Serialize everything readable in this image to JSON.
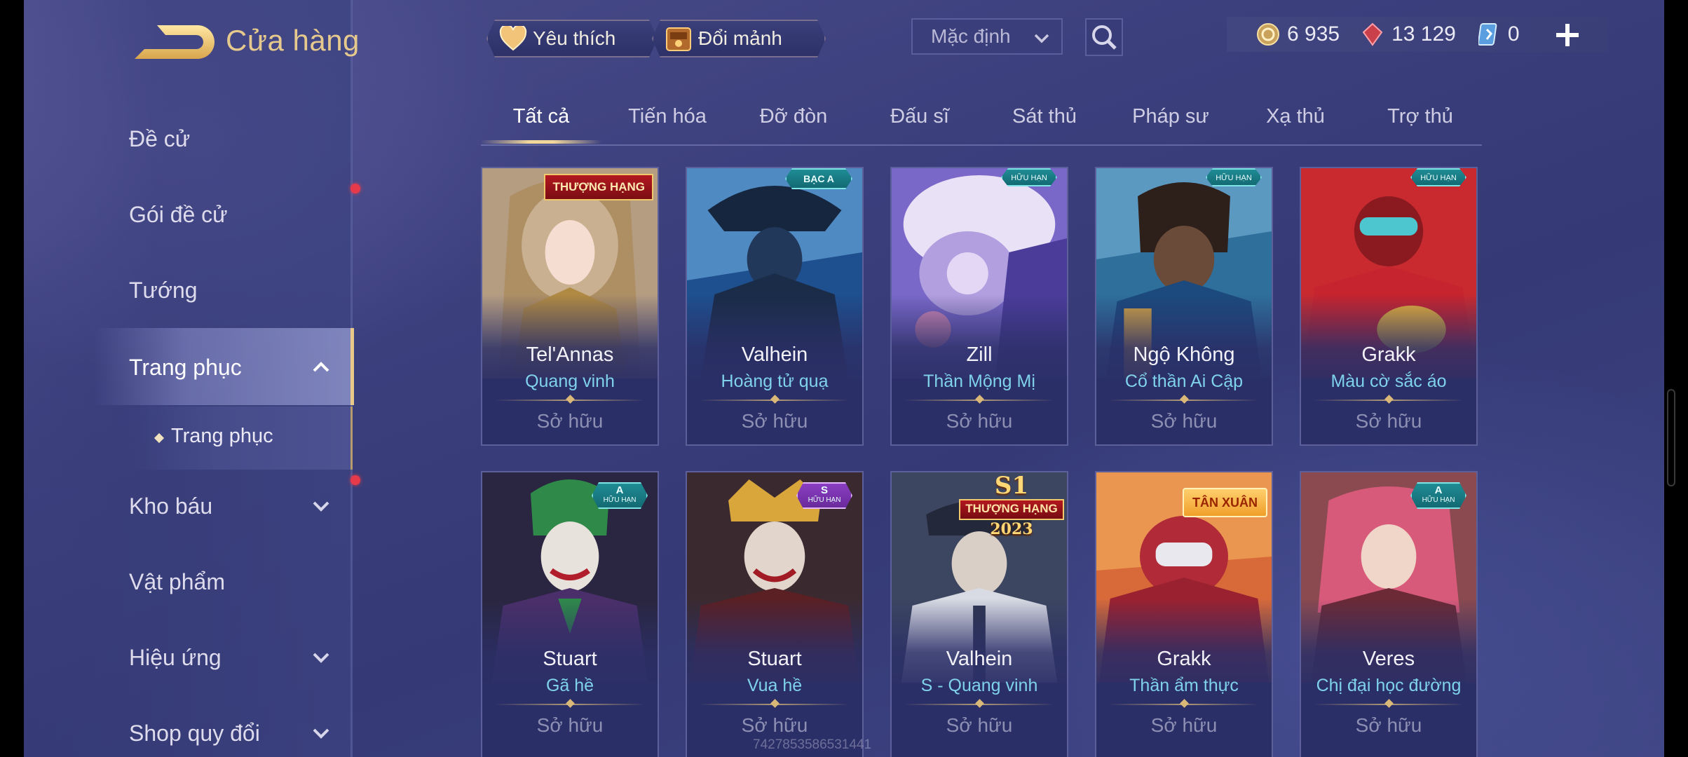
{
  "header": {
    "title": "Cửa hàng",
    "favorites_label": "Yêu thích",
    "shards_label": "Đổi mảnh",
    "sort_value": "Mặc định"
  },
  "currency": [
    {
      "icon": "gold-coin-icon",
      "value": "6 935",
      "color": "#d6b46c"
    },
    {
      "icon": "red-gem-icon",
      "value": "13 129",
      "color": "#c9404a"
    },
    {
      "icon": "blue-crystal-icon",
      "value": "0",
      "color": "#7fb8f0"
    }
  ],
  "sidebar": {
    "items": [
      {
        "label": "Đề cử"
      },
      {
        "label": "Gói đề cử"
      },
      {
        "label": "Tướng"
      },
      {
        "label": "Trang phục"
      },
      {
        "label": "Trang phục"
      },
      {
        "label": "Kho báu"
      },
      {
        "label": "Vật phẩm"
      },
      {
        "label": "Hiệu ứng"
      },
      {
        "label": "Shop quy đổi"
      }
    ]
  },
  "tabs": [
    "Tất cả",
    "Tiến hóa",
    "Đỡ đòn",
    "Đấu sĩ",
    "Sát thủ",
    "Pháp sư",
    "Xạ thủ",
    "Trợ thủ"
  ],
  "cards": [
    {
      "hero": "Tel'Annas",
      "skin": "Quang vinh",
      "status": "Sở hữu",
      "badge": "THƯỢNG HẠNG"
    },
    {
      "hero": "Valhein",
      "skin": "Hoàng tử quạ",
      "status": "Sở hữu",
      "badge": "BẠC A"
    },
    {
      "hero": "Zill",
      "skin": "Thần Mộng Mị",
      "status": "Sở hữu",
      "badge": "HỮU HẠN"
    },
    {
      "hero": "Ngộ Không",
      "skin": "Cổ thần Ai Cập",
      "status": "Sở hữu",
      "badge": "HỮU HẠN"
    },
    {
      "hero": "Grakk",
      "skin": "Màu cờ sắc áo",
      "status": "Sở hữu",
      "badge": "HỮU HẠN"
    },
    {
      "hero": "Stuart",
      "skin": "Gã hề",
      "status": "Sở hữu",
      "badge_big": "A",
      "badge_small": "HỮU HẠN"
    },
    {
      "hero": "Stuart",
      "skin": "Vua hề",
      "status": "Sở hữu",
      "badge_big": "S",
      "badge_small": "HỮU HẠN"
    },
    {
      "hero": "Valhein",
      "skin": "S - Quang vinh",
      "status": "Sở hữu",
      "rank_top": "S1",
      "rank_mid": "THƯỢNG HẠNG",
      "rank_bot": "2023"
    },
    {
      "hero": "Grakk",
      "skin": "Thần ẩm thực",
      "status": "Sở hữu",
      "badge": "TÂN XUÂN"
    },
    {
      "hero": "Veres",
      "skin": "Chị đại học đường",
      "status": "Sở hữu",
      "badge_big": "A",
      "badge_small": "HỮU HẠN"
    }
  ],
  "watermark": "7427853586531441"
}
